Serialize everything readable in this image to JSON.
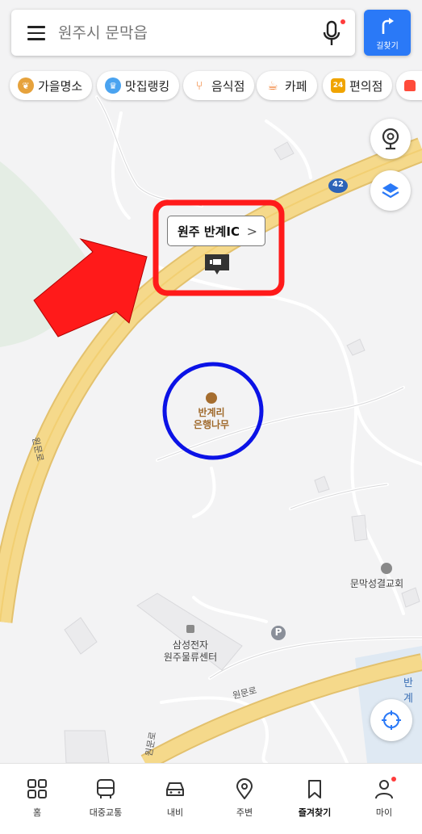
{
  "search": {
    "placeholder": "원주시 문막읍"
  },
  "directions_button": {
    "label": "길찾기"
  },
  "categories": [
    {
      "label": "가을명소",
      "color": "#e6a23c"
    },
    {
      "label": "맛집랭킹",
      "color": "#4aa3f0"
    },
    {
      "label": "음식점",
      "color": "#f07a2a"
    },
    {
      "label": "카페",
      "color": "#f07a2a"
    },
    {
      "label": "편의점",
      "color": "#f0a400",
      "badge": "24"
    }
  ],
  "map": {
    "callout": {
      "label": "원주 반계IC"
    },
    "road_badge": "42",
    "road_label_main": "원문로",
    "road_label_bottom": "원문로",
    "road_label_left": "원문로",
    "poi_tree": {
      "line1": "반계리",
      "line2": "은행나무"
    },
    "poi_church": {
      "label": "문막성결교회"
    },
    "poi_samsung": {
      "line1": "삼성전자",
      "line2": "원주물류센터"
    },
    "parking": "P",
    "edge_label": "반계",
    "colors": {
      "road": "#f5d98b",
      "road_edge": "#e3c16d",
      "annotation_red": "#ff1a1a",
      "annotation_blue": "#0b12e6"
    }
  },
  "bottom_nav": [
    {
      "label": "홈",
      "icon": "grid-icon"
    },
    {
      "label": "대중교통",
      "icon": "bus-icon"
    },
    {
      "label": "내비",
      "icon": "car-icon"
    },
    {
      "label": "주변",
      "icon": "location-pin-icon"
    },
    {
      "label": "즐겨찾기",
      "icon": "bookmark-icon"
    },
    {
      "label": "마이",
      "icon": "person-icon"
    }
  ]
}
